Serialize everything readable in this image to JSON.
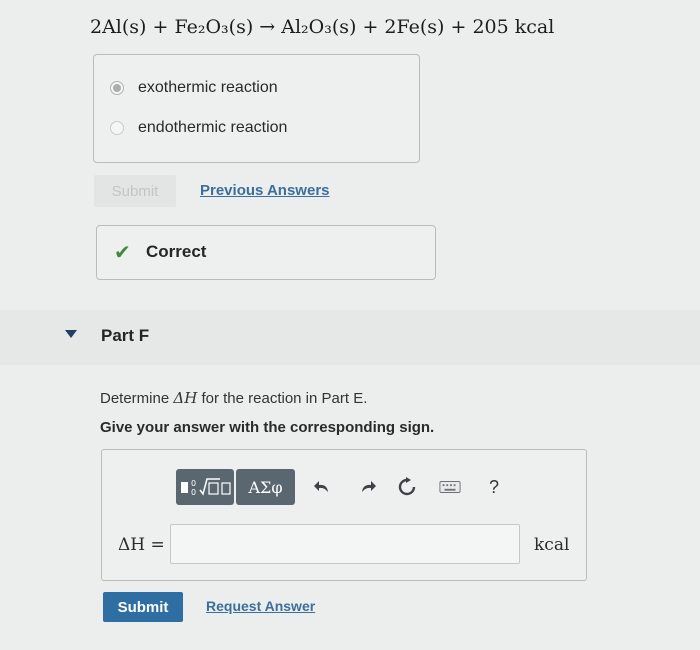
{
  "equation": "2Al(s) + Fe₂O₃(s) → Al₂O₃(s) + 2Fe(s) + 205 kcal",
  "choices": [
    {
      "label": "exothermic reaction",
      "selected": true
    },
    {
      "label": "endothermic reaction",
      "selected": false
    }
  ],
  "prev_submit": {
    "label": "Submit",
    "link": "Previous Answers"
  },
  "feedback": {
    "label": "Correct",
    "icon": "check-icon"
  },
  "part": {
    "label": "Part F"
  },
  "question": {
    "prefix": "Determine ",
    "symbol": "ΔH",
    "suffix": " for the reaction in Part E.",
    "instruction": "Give your answer with the corresponding sign."
  },
  "toolbar": {
    "greek": "ΑΣφ",
    "help": "?"
  },
  "answer": {
    "label": "ΔH =",
    "value": "",
    "unit": "kcal"
  },
  "actions": {
    "submit": "Submit",
    "request": "Request Answer"
  },
  "colors": {
    "accent": "#2f6ea3",
    "link": "#3c6e9c",
    "correct": "#3f8a3a",
    "toolbar": "#5b6770"
  }
}
